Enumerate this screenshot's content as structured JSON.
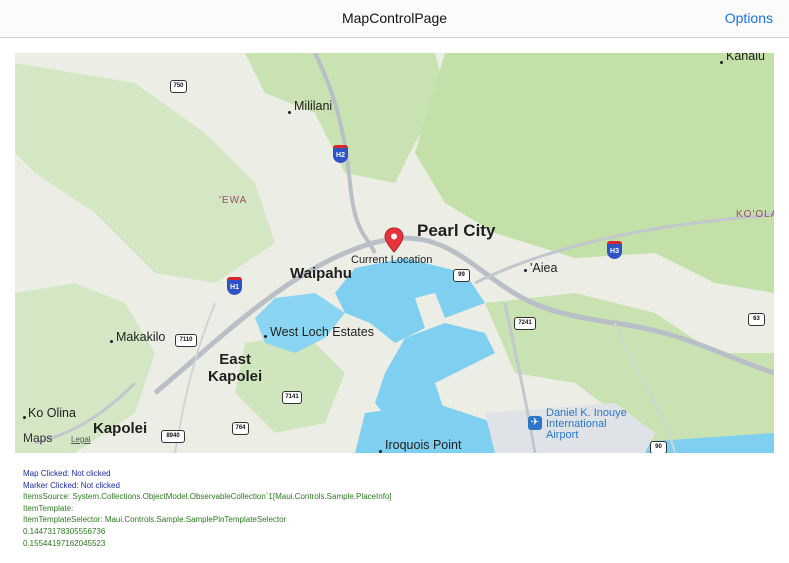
{
  "nav": {
    "title": "MapControlPage",
    "options_label": "Options"
  },
  "map": {
    "labels": {
      "kahalu": "Kahalu",
      "mililani": "Mililani",
      "ewa": "'EWA",
      "pearl_city": "Pearl City",
      "current_location": "Current Location",
      "waipahu": "Waipahu",
      "aiea": "'Aiea",
      "koolau": "KO'OLA",
      "west_loch": "West Loch Estates",
      "makakilo": "Makakilo",
      "east_kapolei": "East\nKapolei",
      "ko_olina": "Ko Olina",
      "kapolei": "Kapolei",
      "daniel_inouye": "Daniel K. Inouye\nInternational\nAirport",
      "iroquois_point": "Iroquois Point"
    },
    "shields": {
      "r750": "750",
      "h2": "H2",
      "h1": "H1",
      "h3": "H3",
      "r99": "99",
      "r7241": "7241",
      "r7110": "7110",
      "r7141": "7141",
      "r8940": "8940",
      "r764": "764",
      "r63": "63",
      "r90": "90"
    },
    "maps_brand": "Maps",
    "legal_label": "Legal",
    "colors": {
      "water": "#7fd0f0",
      "green": "#c8e2b2",
      "road": "#b9bfc6",
      "pin": "#e8333a"
    }
  },
  "info": {
    "map_clicked": "Map Clicked: Not clicked",
    "marker_clicked": "Marker Clicked: Not clicked",
    "items_source": "ItemsSource: System.Collections.ObjectModel.ObservableCollection`1[Maui.Controls.Sample.PlaceInfo]",
    "item_template": "ItemTemplate:",
    "item_template_selector": "ItemTemplateSelector: Maui.Controls.Sample.SamplePinTemplateSelector",
    "value1": "0.14473178305556736",
    "value2": "0.15544197162045523"
  }
}
